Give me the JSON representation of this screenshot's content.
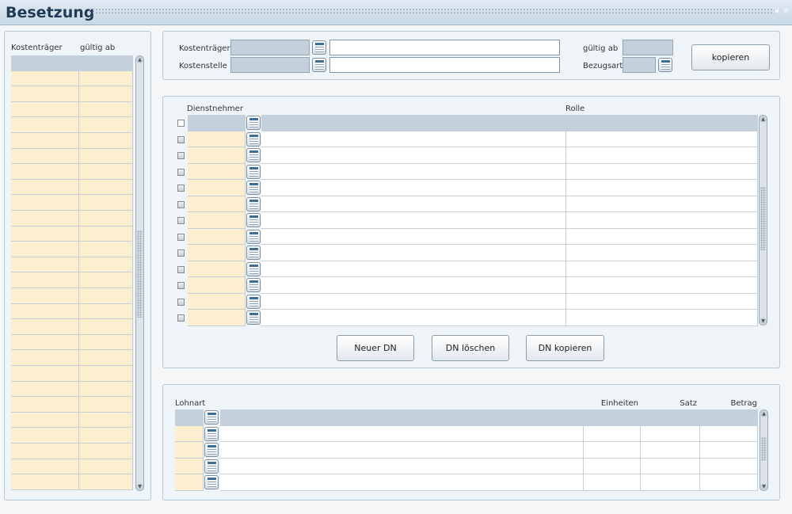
{
  "window": {
    "title": "Besetzung",
    "controls": "⇲ ×"
  },
  "list_panel": {
    "headers": {
      "kostentraeger": "Kostenträger",
      "gueltig_ab": "gültig ab"
    },
    "row_count": 28
  },
  "header_form": {
    "kostentraeger_label": "Kostenträger",
    "kostenstelle_label": "Kostenstelle",
    "gueltig_ab_label": "gültig ab",
    "bezugsart_label": "Bezugsart",
    "kopieren_button": "kopieren"
  },
  "employees": {
    "headers": {
      "dienstnehmer": "Dienstnehmer",
      "rolle": "Rolle"
    },
    "row_count": 12,
    "buttons": {
      "neuer_dn": "Neuer DN",
      "dn_loeschen": "DN löschen",
      "dn_kopieren": "DN kopieren"
    }
  },
  "wages": {
    "headers": {
      "lohnart": "Lohnart",
      "einheiten": "Einheiten",
      "satz": "Satz",
      "betrag": "Betrag"
    },
    "row_count": 4
  }
}
